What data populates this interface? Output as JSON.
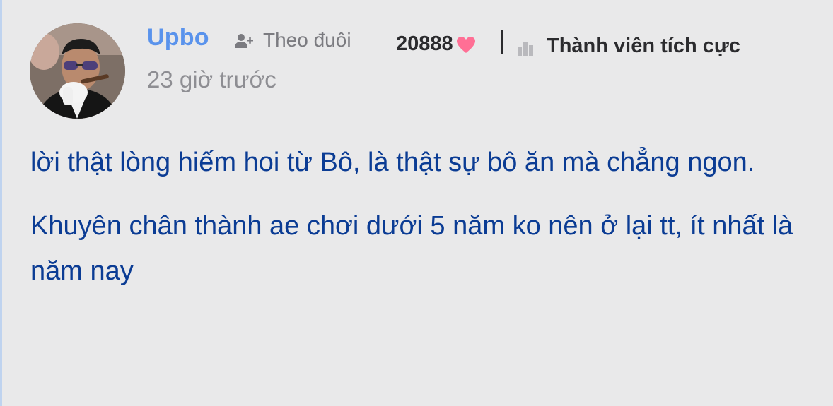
{
  "post": {
    "author": {
      "username": "Upbo",
      "follow_label": "Theo đuôi",
      "points": "20888",
      "rank": "Thành viên tích cực",
      "timestamp": "23 giờ trước"
    },
    "paragraphs": [
      "lời thật lòng hiếm hoi từ Bô, là thật sự bô ăn mà chẳng ngon.",
      "Khuyên chân thành ae chơi dưới 5 năm ko nên ở lại tt, ít nhất là năm nay"
    ]
  },
  "colors": {
    "background": "#e9e9ea",
    "username": "#5a93ec",
    "body_text": "#0b3c94",
    "muted": "#8e8e93",
    "heart": "#ff6f95",
    "strong_text": "#2b2b2e"
  },
  "icons": {
    "follow": "person-plus-icon",
    "heart": "heart-icon",
    "rank": "book-stack-icon"
  }
}
